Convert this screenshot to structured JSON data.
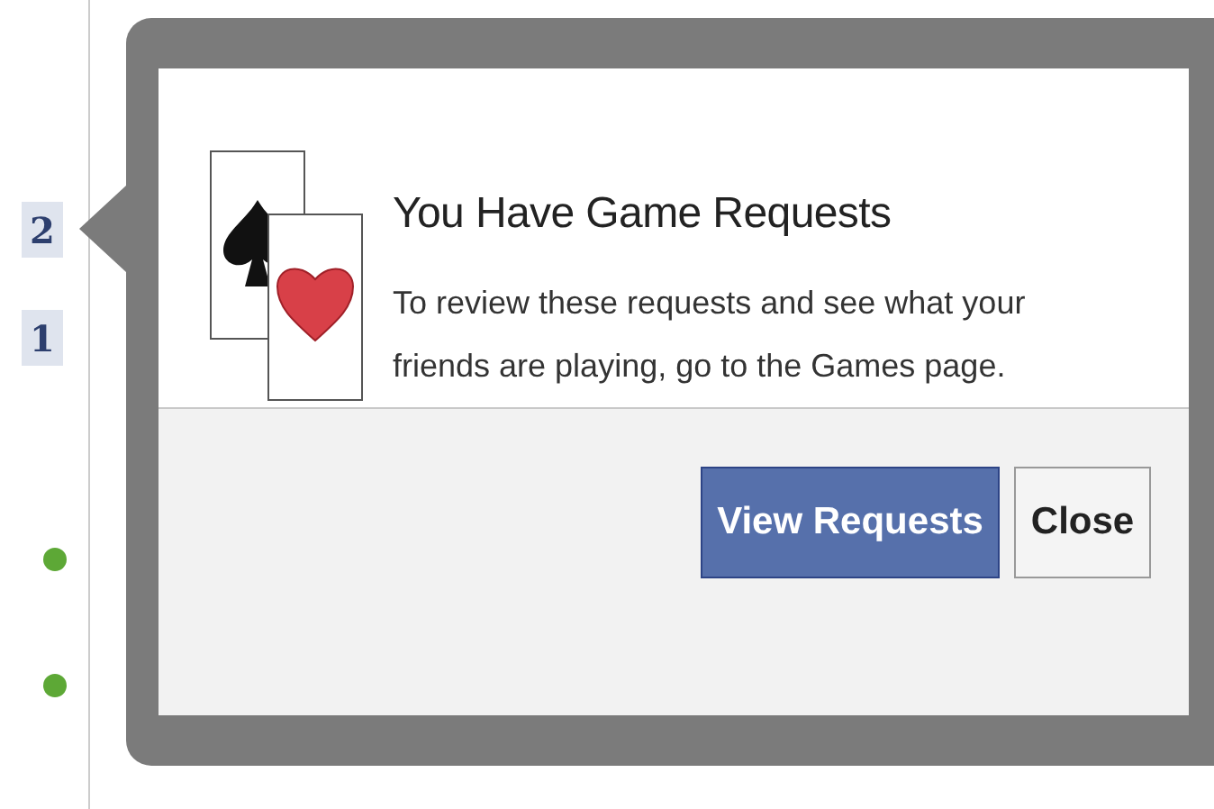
{
  "sidebar": {
    "badges": [
      {
        "count": "2"
      },
      {
        "count": "1"
      }
    ],
    "presence": [
      {
        "online": true
      },
      {
        "online": true
      }
    ]
  },
  "dialog": {
    "title": "You Have Game Requests",
    "message": "To review these requests and see what your friends are playing, go to the Games page.",
    "buttons": [
      {
        "label": "View Requests",
        "kind": "primary"
      },
      {
        "label": "Close",
        "kind": "secondary"
      }
    ]
  }
}
